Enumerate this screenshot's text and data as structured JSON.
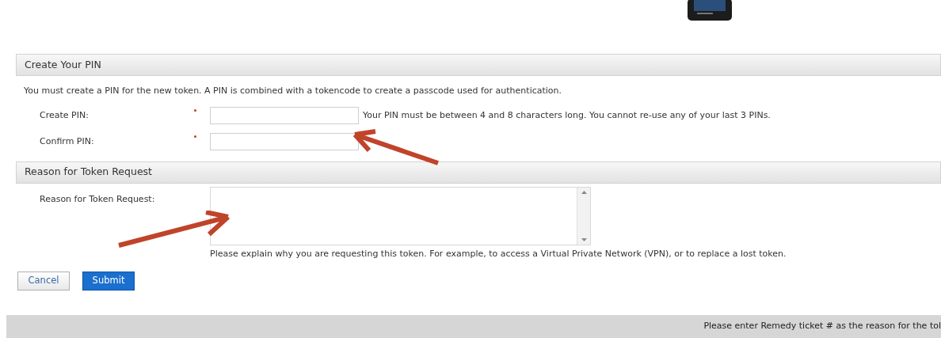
{
  "sections": [
    {
      "title": "Create Your PIN",
      "description": "You must create a PIN for the new token. A PIN is combined with a tokencode to create a passcode used for authentication.",
      "fields": [
        {
          "kind": "input",
          "label": "Create PIN:",
          "required": true,
          "hint": "Your PIN must be between 4 and 8 characters long. You cannot re-use any of your last 3 PINs."
        },
        {
          "kind": "input",
          "label": "Confirm PIN:",
          "required": true
        }
      ]
    },
    {
      "title": "Reason for Token Request",
      "fields": [
        {
          "kind": "textarea",
          "label": "Reason for Token Request:",
          "hint": "Please explain why you are requesting this token. For example, to access a Virtual Private Network (VPN), or to replace a lost token."
        }
      ]
    }
  ],
  "buttons": [
    {
      "label": "Cancel",
      "kind": "secondary"
    },
    {
      "label": "Submit",
      "kind": "primary"
    }
  ],
  "footer": {
    "note": "Please enter Remedy ticket # as the reason for the tol"
  }
}
